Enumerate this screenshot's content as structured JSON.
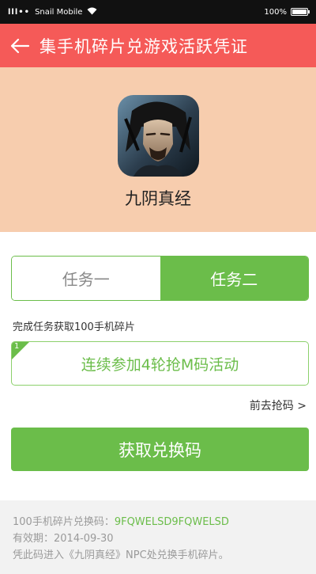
{
  "status_bar": {
    "signal": "lll••",
    "carrier": "Snail Mobile",
    "battery": "100%",
    "battery_level": 1.0
  },
  "header": {
    "title": "集手机碎片兑游戏活跃凭证",
    "back_icon": "arrow-left-icon",
    "color": "#f55a58"
  },
  "game": {
    "name": "九阴真经",
    "icon": "game-app-icon"
  },
  "tabs": [
    {
      "label": "任务一",
      "active": false
    },
    {
      "label": "任务二",
      "active": true
    }
  ],
  "task": {
    "description": "完成任务获取100手机碎片",
    "number": "1",
    "text": "连续参加4轮抢M码活动",
    "link_label": "前去抢码 >"
  },
  "action": {
    "get_code_label": "获取兑换码",
    "accent": "#6bbd4a"
  },
  "footer": {
    "code_label": "100手机碎片兑换码：",
    "code_value": "9FQWELSD9FQWELSD",
    "expiry": "有效期：2014-09-30",
    "note": "凭此码进入《九阴真经》NPC处兑换手机碎片。"
  }
}
